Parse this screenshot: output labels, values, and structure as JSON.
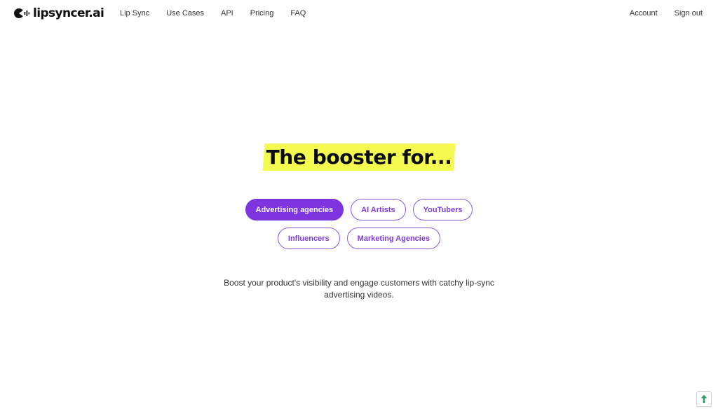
{
  "brand": {
    "name": "lipsyncer.ai",
    "icon": "lipsyncer-logo-icon"
  },
  "nav": {
    "items": [
      {
        "label": "Lip Sync"
      },
      {
        "label": "Use Cases"
      },
      {
        "label": "API"
      },
      {
        "label": "Pricing"
      },
      {
        "label": "FAQ"
      }
    ],
    "account_label": "Account",
    "signout_label": "Sign out"
  },
  "hero": {
    "headline": "The booster for...",
    "highlight_color": "#f4fa50",
    "accent_color": "#7e34df",
    "categories": [
      {
        "label": "Advertising agencies",
        "selected": true
      },
      {
        "label": "AI Artists",
        "selected": false
      },
      {
        "label": "YouTubers",
        "selected": false
      },
      {
        "label": "Influencers",
        "selected": false
      },
      {
        "label": "Marketing Agencies",
        "selected": false
      }
    ],
    "description": "Boost your product's visibility and engage customers with catchy lip-sync advertising videos."
  },
  "scroll_top": {
    "icon": "arrow-up-icon",
    "color": "#2e9d6a"
  }
}
